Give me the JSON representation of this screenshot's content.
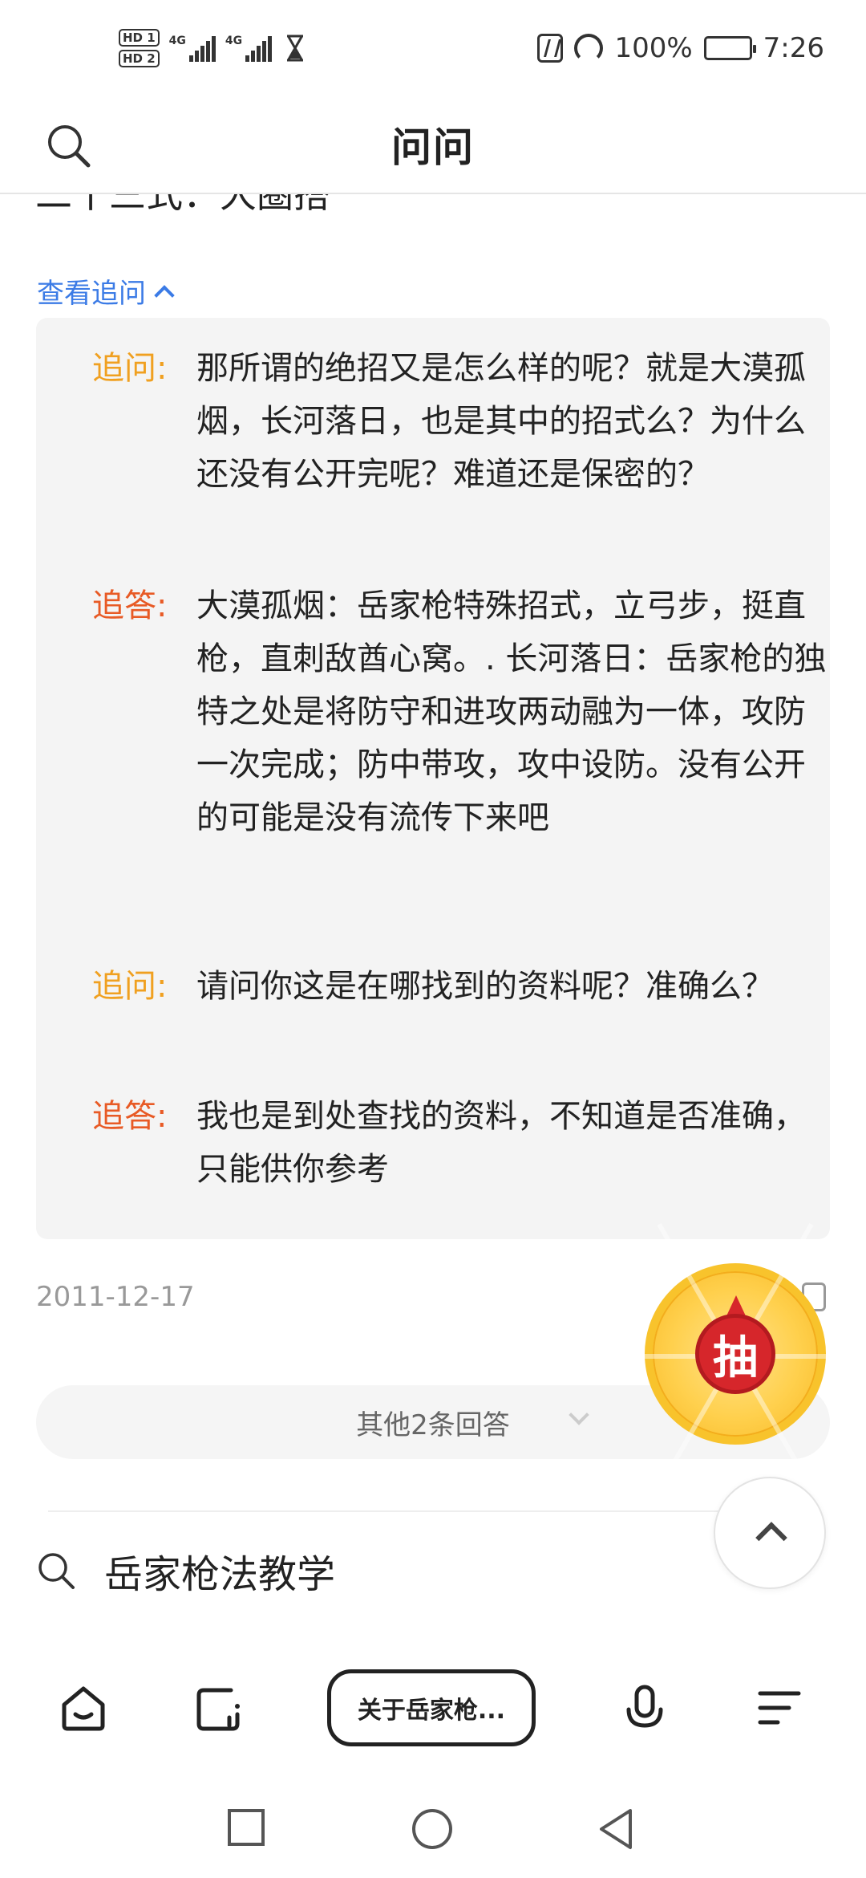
{
  "status_bar": {
    "hd1": "HD 1",
    "hd2": "HD 2",
    "net1": "4G",
    "net2": "4G",
    "battery": "100%",
    "time": "7:26"
  },
  "header": {
    "title": "问问"
  },
  "answer": {
    "toggle_label": "查看追问",
    "thread": [
      {
        "label": "追问:",
        "kind": "question",
        "text": "那所谓的绝招又是怎么样的呢？就是大漠孤烟，长河落日，也是其中的招式么？为什么还没有公开完呢？难道还是保密的？"
      },
      {
        "label": "追答:",
        "kind": "answer",
        "text": "大漠孤烟：岳家枪特殊招式，立弓步，挺直枪，直刺敌酋心窝。. 长河落日：岳家枪的独特之处是将防守和进攻两动融为一体，攻防一次完成；防中带攻，攻中设防。没有公开的可能是没有流传下来吧"
      },
      {
        "label": "追问:",
        "kind": "question",
        "text": "请问你这是在哪找到的资料呢？准确么？"
      },
      {
        "label": "追答:",
        "kind": "answer",
        "text": "我也是到处查找的资料，不知道是否准确，只能供你参考"
      }
    ],
    "date": "2011-12-17"
  },
  "lottery": {
    "label": "抽"
  },
  "more_answers": {
    "label": "其他2条回答"
  },
  "related_search": {
    "label": "岳家枪法教学"
  },
  "bottom_bar": {
    "pill_label": "关于岳家枪..."
  },
  "colors": {
    "link": "#3b7be6",
    "question_label": "#f0a020",
    "answer_label": "#e85a25",
    "panel_bg": "#f4f4f4"
  },
  "icons": [
    "search-icon",
    "chevron-up-icon",
    "like-icon",
    "back-to-top-icon",
    "home-icon",
    "tabs-icon",
    "mic-icon",
    "menu-icon",
    "recent-apps-icon",
    "home-nav-icon",
    "back-nav-icon"
  ]
}
